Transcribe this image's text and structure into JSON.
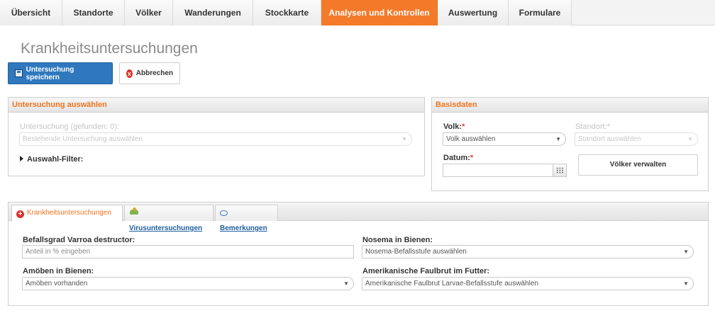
{
  "nav": {
    "items": [
      {
        "label": "Übersicht",
        "width": 88
      },
      {
        "label": "Standorte",
        "width": 88
      },
      {
        "label": "Völker",
        "width": 68
      },
      {
        "label": "Wanderungen",
        "width": 113
      },
      {
        "label": "Stockkarte",
        "width": 96
      },
      {
        "label": "Analysen und Kontrollen",
        "width": 164
      },
      {
        "label": "Auswertung",
        "width": 100
      },
      {
        "label": "Formulare",
        "width": 89
      }
    ],
    "active_index": 5
  },
  "page": {
    "title": "Krankheitsuntersuchungen"
  },
  "toolbar": {
    "save_label": "Untersuchung speichern",
    "cancel_label": "Abbrechen",
    "cancel_icon": "x"
  },
  "select_panel": {
    "title": "Untersuchung auswählen",
    "field_label": "Untersuchung (gefunden: 0):",
    "field_placeholder": "Bestehende Untersuchung auswählen",
    "filter_label": "Auswahl-Filter:"
  },
  "base_panel": {
    "title": "Basisdaten",
    "volk_label": "Volk:",
    "volk_placeholder": "Volk auswählen",
    "standort_label": "Standort:",
    "standort_placeholder": "Standort auswählen",
    "datum_label": "Datum:",
    "datum_value": "",
    "required_mark": "*",
    "manage_button": "Völker verwalten"
  },
  "tabs": {
    "items": [
      {
        "label": "Krankheitsuntersuchungen",
        "icon": "plus",
        "active": true
      },
      {
        "label": "Virusuntersuchungen",
        "icon": "virus",
        "active": false
      },
      {
        "label": "Bemerkungen",
        "icon": "speech-bubble",
        "active": false
      }
    ]
  },
  "form": {
    "varroa_label": "Befallsgrad Varroa destructor:",
    "varroa_placeholder": "Anteil in % eingeben",
    "nosema_label": "Nosema in Bienen:",
    "nosema_placeholder": "Nosema-Befallsstufe auswählen",
    "amoeben_label": "Amöben in Bienen:",
    "amoeben_value": "Amöben vorhanden",
    "faulbrut_label": "Amerikanische Faulbrut im Futter:",
    "faulbrut_placeholder": "Amerikanische Faulbrut Larvae-Befallsstufe auswählen"
  },
  "colors": {
    "accent": "#f47a2a",
    "primary": "#2f78be",
    "required": "#e23c3c"
  }
}
